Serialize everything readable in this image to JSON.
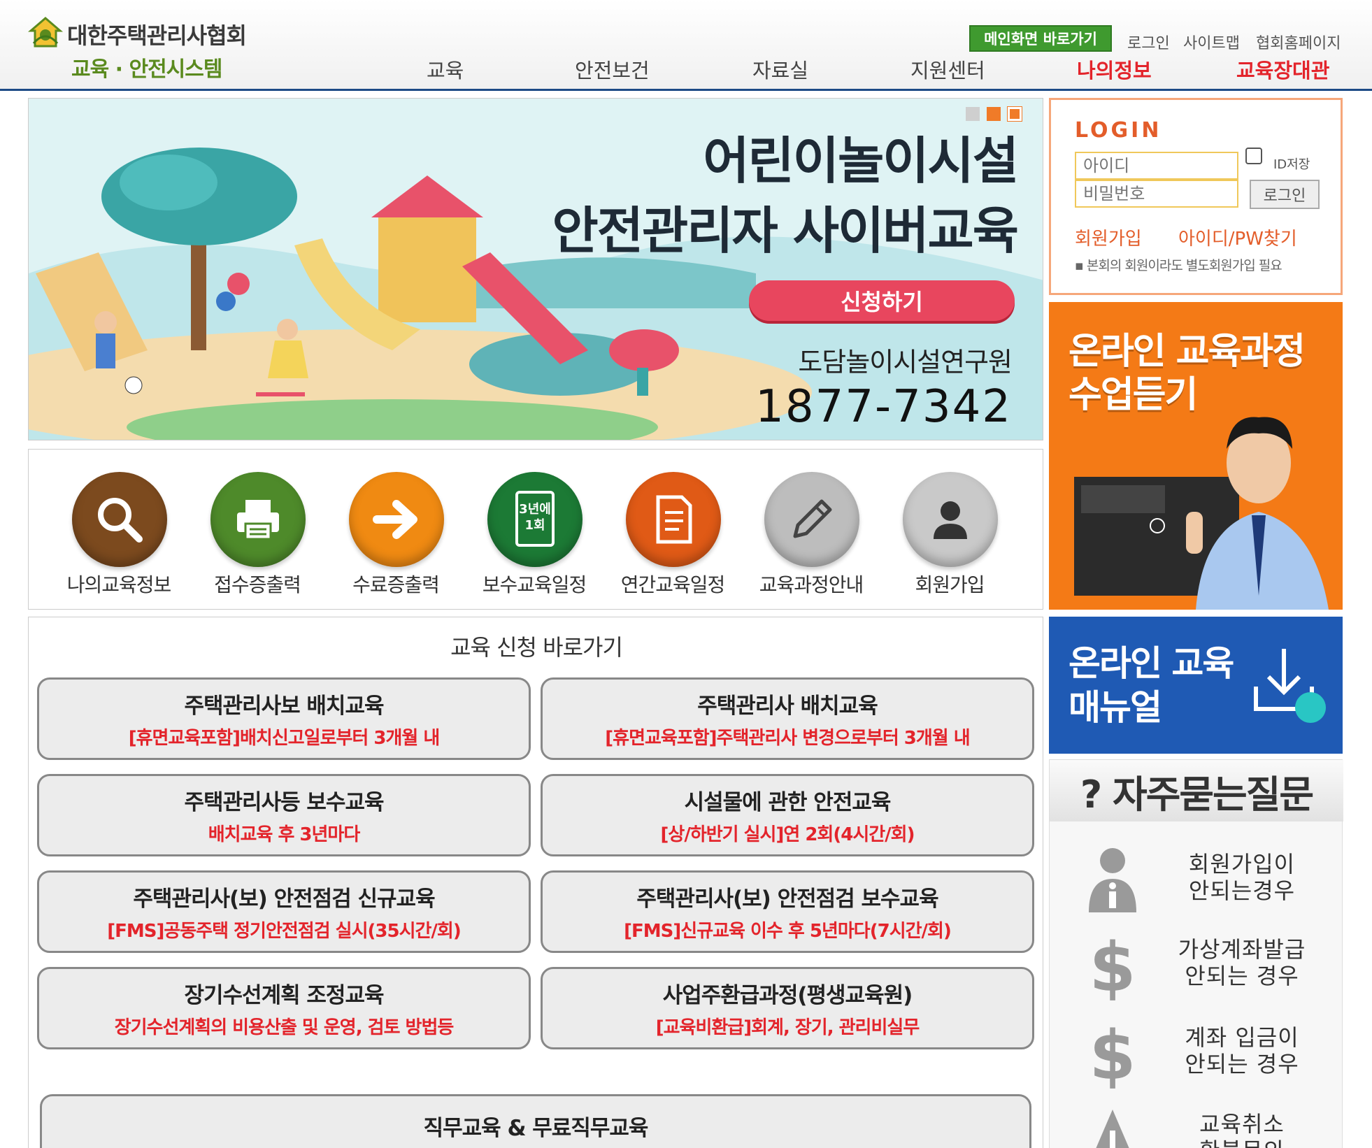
{
  "header": {
    "org_name": "대한주택관리사협회",
    "system_name": "교육 · 안전시스템",
    "main_link": "메인화면 바로가기",
    "util_links": [
      "로그인",
      "사이트맵",
      "협회홈페이지"
    ],
    "nav": [
      "교육",
      "안전보건",
      "자료실",
      "지원센터",
      "나의정보",
      "교육장대관"
    ]
  },
  "hero": {
    "title_1": "어린이놀이시설",
    "title_2": "안전관리자 사이버교육",
    "apply_label": "신청하기",
    "institute": "도담놀이시설연구원",
    "phone": "1877-7342"
  },
  "quick_menu": [
    {
      "label": "나의교육정보",
      "icon": "search-icon",
      "color": "#7c4a1e"
    },
    {
      "label": "접수증출력",
      "icon": "printer-icon",
      "color": "#4e8a2a"
    },
    {
      "label": "수료증출력",
      "icon": "arrow-right-icon",
      "color": "#f08a12"
    },
    {
      "label": "보수교육일정",
      "icon": "calendar-icon",
      "color": "#1c7a35",
      "icon_text": [
        "3년에",
        "1회"
      ]
    },
    {
      "label": "연간교육일정",
      "icon": "document-icon",
      "color": "#e05a16"
    },
    {
      "label": "교육과정안내",
      "icon": "pencil-icon",
      "color": "#bdbdbd"
    },
    {
      "label": "회원가입",
      "icon": "user-icon",
      "color": "#c9c9c9"
    }
  ],
  "apply": {
    "title": "교육 신청 바로가기",
    "courses": [
      {
        "title": "주택관리사보 배치교육",
        "sub": "[휴면교육포함]배치신고일로부터 3개월 내"
      },
      {
        "title": "주택관리사 배치교육",
        "sub": "[휴면교육포함]주택관리사 변경으로부터 3개월 내"
      },
      {
        "title": "주택관리사등 보수교육",
        "sub": "배치교육 후 3년마다"
      },
      {
        "title": "시설물에 관한 안전교육",
        "sub": "[상/하반기 실시]연 2회(4시간/회)"
      },
      {
        "title": "주택관리사(보) 안전점검 신규교육",
        "sub": "[FMS]공동주택 정기안전점검 실시(35시간/회)"
      },
      {
        "title": "주택관리사(보) 안전점검 보수교육",
        "sub": "[FMS]신규교육 이수 후 5년마다(7시간/회)"
      },
      {
        "title": "장기수선계획 조정교육",
        "sub": "장기수선계획의 비용산출 및 운영, 검토 방법등"
      },
      {
        "title": "사업주환급과정(평생교육원)",
        "sub": "[교육비환급]회계, 장기, 관리비실무"
      }
    ],
    "wide_course": {
      "title": "직무교육 & 무료직무교육"
    }
  },
  "login": {
    "title": "LOGIN",
    "id_placeholder": "아이디",
    "pw_placeholder": "비밀번호",
    "save_id": "ID저장",
    "login_button": "로그인",
    "join": "회원가입",
    "find": "아이디/PW찾기",
    "note": "본회의 회원이라도 별도회원가입 필요"
  },
  "online_banner": {
    "line1": "온라인 교육과정",
    "line2": "수업듣기"
  },
  "manual_banner": {
    "line1": "온라인 교육",
    "line2": "매뉴얼"
  },
  "faq": {
    "title": "? 자주묻는질문",
    "items": [
      {
        "line1": "회원가입이",
        "line2": "안되는경우",
        "icon": "info-person-icon"
      },
      {
        "line1": "가상계좌발급",
        "line2": "안되는 경우",
        "icon": "dollar-icon"
      },
      {
        "line1": "계좌 입금이",
        "line2": "안되는 경우",
        "icon": "dollar-icon"
      },
      {
        "line1": "교육취소",
        "line2": "환불문의",
        "icon": "warning-icon"
      }
    ]
  },
  "colors": {
    "accent_red": "#e3242b",
    "nav_border": "#1c4a86",
    "login_orange": "#e35d2a",
    "online_orange": "#f47a16",
    "manual_blue": "#1f5ab4"
  }
}
